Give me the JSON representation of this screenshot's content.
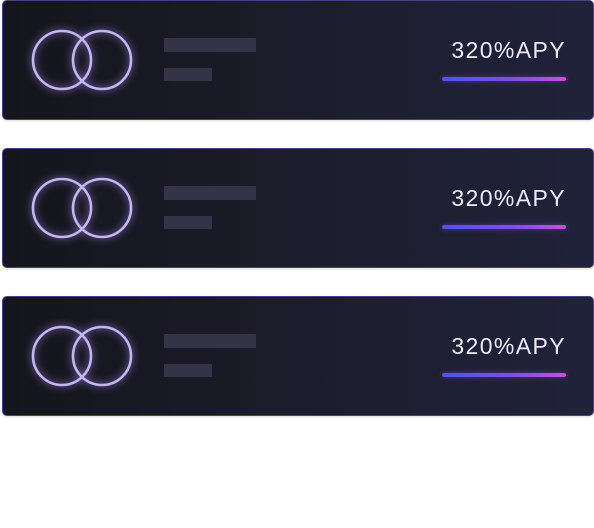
{
  "theme": {
    "ring_color": "#c4b6ee",
    "ring_glow": "#9c84e6",
    "border_color": "#4b3f86",
    "accent_gradient": [
      "#4a55f2",
      "#c84de0"
    ]
  },
  "cards": [
    {
      "logo_icon": "double-ring-icon",
      "apy_value": "320%",
      "apy_unit": "APY",
      "apy_text": "320%APY"
    },
    {
      "logo_icon": "double-ring-icon",
      "apy_value": "320%",
      "apy_unit": "APY",
      "apy_text": "320%APY"
    },
    {
      "logo_icon": "double-ring-icon",
      "apy_value": "320%",
      "apy_unit": "APY",
      "apy_text": "320%APY"
    }
  ]
}
